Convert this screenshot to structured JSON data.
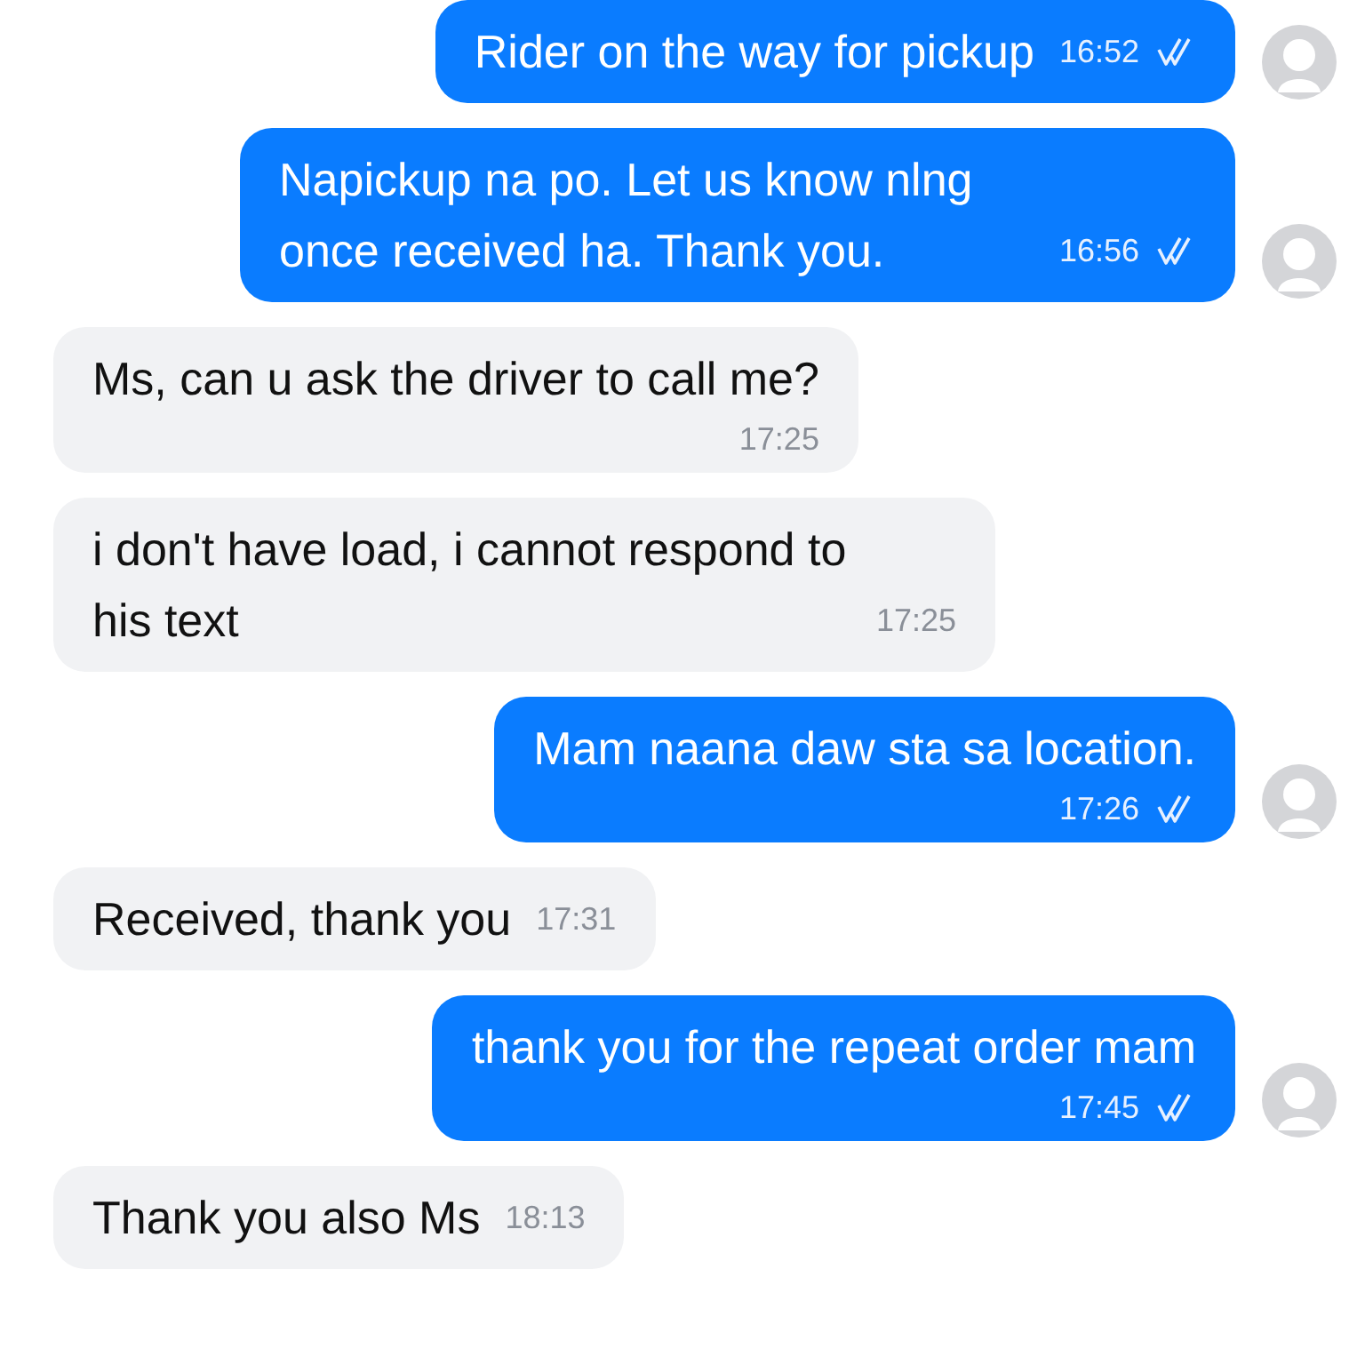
{
  "messages": [
    {
      "sent": true,
      "kind": "inline",
      "text": "Rider on the way for pickup",
      "time": "16:52"
    },
    {
      "sent": true,
      "kind": "inline",
      "text": "Napickup na po. Let us know nlng once received ha. Thank you.",
      "time": "16:56"
    },
    {
      "sent": false,
      "kind": "stacked",
      "text": "Ms, can u ask the driver to call me?",
      "time": "17:25"
    },
    {
      "sent": false,
      "kind": "inline",
      "text": "i don't have load, i cannot respond to his text",
      "time": "17:25"
    },
    {
      "sent": true,
      "kind": "stacked",
      "text": "Mam naana daw sta sa location.",
      "time": "17:26"
    },
    {
      "sent": false,
      "kind": "inline",
      "text": "Received, thank you",
      "time": "17:31"
    },
    {
      "sent": true,
      "kind": "stacked",
      "text": "thank you for the repeat order mam",
      "time": "17:45"
    },
    {
      "sent": false,
      "kind": "inline",
      "text": "Thank you also Ms",
      "time": "18:13"
    }
  ]
}
